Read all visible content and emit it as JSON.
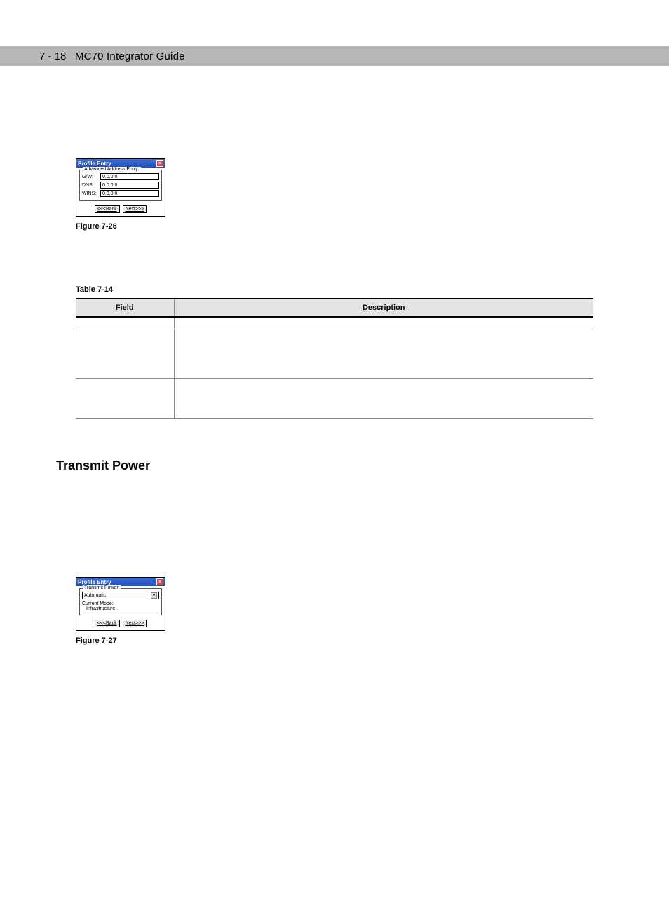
{
  "header": {
    "page_number": "7 - 18",
    "title": "MC70 Integrator Guide"
  },
  "dialog1": {
    "title": "Profile Entry",
    "legend": "Advanced Address Entry:",
    "rows": [
      {
        "label": "G/W:",
        "value": "0.0.0.0"
      },
      {
        "label": "DNS:",
        "value": "0.0.0.0"
      },
      {
        "label": "WINS:",
        "value": "0.0.0.0"
      }
    ],
    "back": "<<<Back",
    "next": "Next>>>"
  },
  "figure26": {
    "label": "Figure 7-26",
    "caption": ""
  },
  "table14": {
    "label": "Table 7-14",
    "caption": "",
    "headers": {
      "field": "Field",
      "description": "Description"
    },
    "rows": [
      {
        "field": "",
        "description": ""
      },
      {
        "field": "",
        "description": ""
      },
      {
        "field": "",
        "description": ""
      }
    ]
  },
  "section": {
    "heading": "Transmit Power"
  },
  "dialog2": {
    "title": "Profile Entry",
    "legend": "Transmit Power:",
    "dropdown": "Automatic",
    "mode_label": "Current Mode:",
    "mode_value": "Infrastructure",
    "back": "<<<Back",
    "next": "Next>>>"
  },
  "figure27": {
    "label": "Figure 7-27",
    "caption": ""
  }
}
